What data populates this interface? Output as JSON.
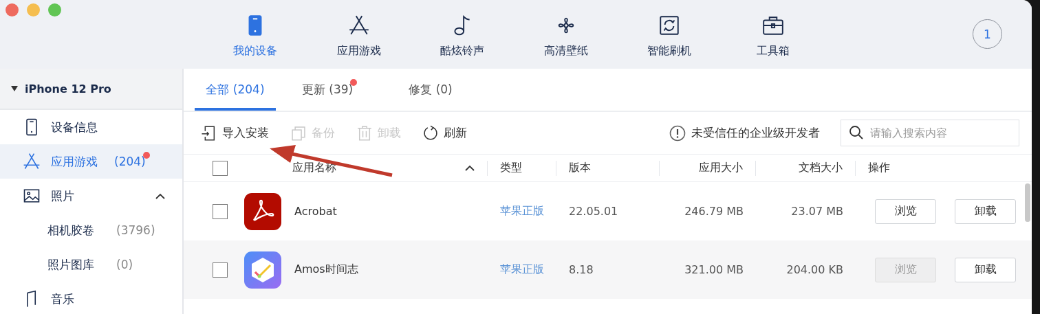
{
  "nav": [
    {
      "label": "我的设备",
      "selected": true
    },
    {
      "label": "应用游戏",
      "selected": false
    },
    {
      "label": "酷炫铃声",
      "selected": false
    },
    {
      "label": "高清壁纸",
      "selected": false
    },
    {
      "label": "智能刷机",
      "selected": false
    },
    {
      "label": "工具箱",
      "selected": false
    }
  ],
  "notification_count": "1",
  "sidebar": {
    "device": "iPhone 12 Pro",
    "items": [
      {
        "label": "设备信息",
        "selected": false
      },
      {
        "label": "应用游戏",
        "count": "(204)",
        "selected": true,
        "dot": true
      },
      {
        "label": "照片",
        "selected": false,
        "expanded": true,
        "children": [
          {
            "label": "相机胶卷",
            "count": "(3796)"
          },
          {
            "label": "照片图库",
            "count": "(0)"
          }
        ]
      },
      {
        "label": "音乐",
        "selected": false
      }
    ]
  },
  "tabs": [
    {
      "label": "全部 (204)",
      "selected": true,
      "dot": false
    },
    {
      "label": "更新 (39)",
      "selected": false,
      "dot": true
    },
    {
      "label": "修复 (0)",
      "selected": false,
      "dot": false
    }
  ],
  "toolbar": [
    {
      "label": "导入安装",
      "disabled": false
    },
    {
      "label": "备份",
      "disabled": true
    },
    {
      "label": "卸载",
      "disabled": true
    },
    {
      "label": "刷新",
      "disabled": false
    }
  ],
  "trust_link": "未受信任的企业级开发者",
  "search": {
    "placeholder": "请输入搜索内容"
  },
  "table": {
    "all_checked": false,
    "columns": [
      "应用名称",
      "类型",
      "版本",
      "应用大小",
      "文档大小",
      "操作"
    ],
    "rows": [
      {
        "checked": false,
        "name": "Acrobat",
        "type": "苹果正版",
        "version": "22.05.01",
        "app_size": "246.79 MB",
        "doc_size": "23.07 MB",
        "actions": [
          {
            "label": "浏览",
            "disabled": false
          },
          {
            "label": "卸载",
            "disabled": false
          }
        ]
      },
      {
        "checked": false,
        "name": "Amos时间志",
        "type": "苹果正版",
        "version": "8.18",
        "app_size": "321.00 MB",
        "doc_size": "204.00 KB",
        "actions": [
          {
            "label": "浏览",
            "disabled": true
          },
          {
            "label": "卸载",
            "disabled": false
          }
        ]
      }
    ]
  }
}
